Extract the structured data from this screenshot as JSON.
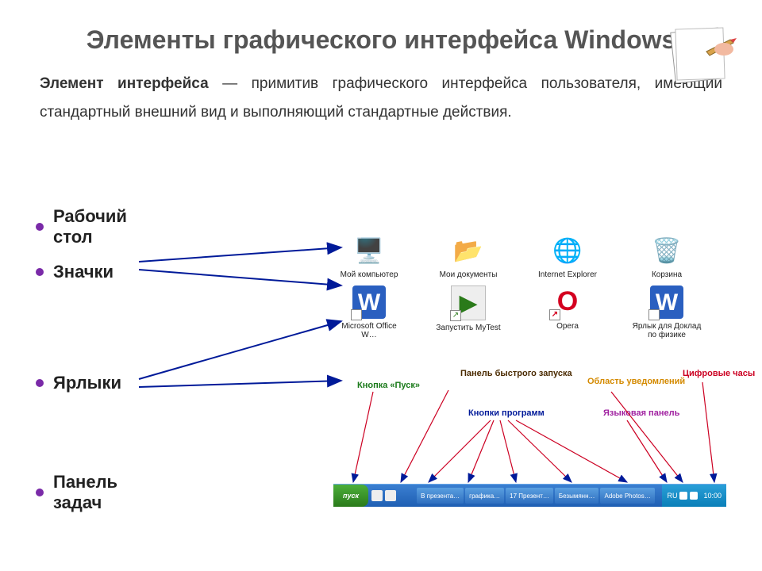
{
  "title": "Элементы графического интерфейса Windows",
  "definition_term": "Элемент интерфейса",
  "definition_rest": " — примитив графического интерфейса пользователя, имеющий стандартный внешний вид и выполняющий стандартные действия.",
  "bullets": {
    "b1": "Рабочий стол",
    "b2": "Значки",
    "b3": "Ярлыки",
    "b4": "Панель задач"
  },
  "icons_row1": [
    {
      "label": "Мой компьютер",
      "glyph": "🖥️"
    },
    {
      "label": "Мои документы",
      "glyph": "📂"
    },
    {
      "label": "Internet Explorer",
      "glyph": "🌐"
    },
    {
      "label": "Корзина",
      "glyph": "🗑️"
    }
  ],
  "icons_row2": [
    {
      "label": "Microsoft Office W…",
      "glyph": "W"
    },
    {
      "label": "Запустить MyTest",
      "glyph": "▶"
    },
    {
      "label": "Opera",
      "glyph": "O"
    },
    {
      "label": "Ярлык для Доклад по физике",
      "glyph": "W"
    }
  ],
  "annotations": {
    "quick": "Панель быстрого запуска",
    "start": "Кнопка «Пуск»",
    "notif": "Область уведомлений",
    "clock": "Цифровые часы",
    "programs": "Кнопки программ",
    "lang": "Языковая панель"
  },
  "taskbar": {
    "start": "пуск",
    "buttons": [
      "В презента…",
      "графика…",
      "17 Презент…",
      "Безымянн…",
      "Adobe Photos…"
    ],
    "lang": "RU",
    "time": "10:00"
  }
}
